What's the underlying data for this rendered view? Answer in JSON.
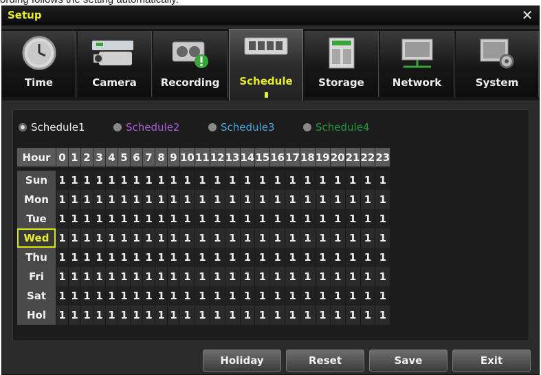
{
  "top_caption": "ording follows the setting automatically.",
  "window": {
    "title": "Setup"
  },
  "tabs": [
    {
      "id": "time",
      "label": "Time",
      "icon": "clock-icon",
      "active": false
    },
    {
      "id": "camera",
      "label": "Camera",
      "icon": "camera-icon",
      "active": false
    },
    {
      "id": "recording",
      "label": "Recording",
      "icon": "recording-icon",
      "active": false
    },
    {
      "id": "schedule",
      "label": "Schedule",
      "icon": "schedule-icon",
      "active": true
    },
    {
      "id": "storage",
      "label": "Storage",
      "icon": "storage-icon",
      "active": false
    },
    {
      "id": "network",
      "label": "Network",
      "icon": "network-icon",
      "active": false
    },
    {
      "id": "system",
      "label": "System",
      "icon": "system-gear-icon",
      "active": false
    }
  ],
  "schedules": [
    {
      "label": "Schedule1",
      "color": "#f0f0f0",
      "selected": true
    },
    {
      "label": "Schedule2",
      "color": "#a95bd6",
      "selected": false
    },
    {
      "label": "Schedule3",
      "color": "#4aa6e0",
      "selected": false
    },
    {
      "label": "Schedule4",
      "color": "#1f9a3c",
      "selected": false
    }
  ],
  "grid": {
    "hour_label": "Hour",
    "hours": [
      "0",
      "1",
      "2",
      "3",
      "4",
      "5",
      "6",
      "7",
      "8",
      "9",
      "10",
      "11",
      "12",
      "13",
      "14",
      "15",
      "16",
      "17",
      "18",
      "19",
      "20",
      "21",
      "22",
      "23"
    ],
    "rows": [
      {
        "day": "Sun",
        "values": [
          "1",
          "1",
          "1",
          "1",
          "1",
          "1",
          "1",
          "1",
          "1",
          "1",
          "1",
          "1",
          "1",
          "1",
          "1",
          "1",
          "1",
          "1",
          "1",
          "1",
          "1",
          "1",
          "1",
          "1"
        ]
      },
      {
        "day": "Mon",
        "values": [
          "1",
          "1",
          "1",
          "1",
          "1",
          "1",
          "1",
          "1",
          "1",
          "1",
          "1",
          "1",
          "1",
          "1",
          "1",
          "1",
          "1",
          "1",
          "1",
          "1",
          "1",
          "1",
          "1",
          "1"
        ]
      },
      {
        "day": "Tue",
        "values": [
          "1",
          "1",
          "1",
          "1",
          "1",
          "1",
          "1",
          "1",
          "1",
          "1",
          "1",
          "1",
          "1",
          "1",
          "1",
          "1",
          "1",
          "1",
          "1",
          "1",
          "1",
          "1",
          "1",
          "1"
        ]
      },
      {
        "day": "Wed",
        "values": [
          "1",
          "1",
          "1",
          "1",
          "1",
          "1",
          "1",
          "1",
          "1",
          "1",
          "1",
          "1",
          "1",
          "1",
          "1",
          "1",
          "1",
          "1",
          "1",
          "1",
          "1",
          "1",
          "1",
          "1"
        ],
        "focused": true
      },
      {
        "day": "Thu",
        "values": [
          "1",
          "1",
          "1",
          "1",
          "1",
          "1",
          "1",
          "1",
          "1",
          "1",
          "1",
          "1",
          "1",
          "1",
          "1",
          "1",
          "1",
          "1",
          "1",
          "1",
          "1",
          "1",
          "1",
          "1"
        ]
      },
      {
        "day": "Fri",
        "values": [
          "1",
          "1",
          "1",
          "1",
          "1",
          "1",
          "1",
          "1",
          "1",
          "1",
          "1",
          "1",
          "1",
          "1",
          "1",
          "1",
          "1",
          "1",
          "1",
          "1",
          "1",
          "1",
          "1",
          "1"
        ]
      },
      {
        "day": "Sat",
        "values": [
          "1",
          "1",
          "1",
          "1",
          "1",
          "1",
          "1",
          "1",
          "1",
          "1",
          "1",
          "1",
          "1",
          "1",
          "1",
          "1",
          "1",
          "1",
          "1",
          "1",
          "1",
          "1",
          "1",
          "1"
        ]
      },
      {
        "day": "Hol",
        "values": [
          "1",
          "1",
          "1",
          "1",
          "1",
          "1",
          "1",
          "1",
          "1",
          "1",
          "1",
          "1",
          "1",
          "1",
          "1",
          "1",
          "1",
          "1",
          "1",
          "1",
          "1",
          "1",
          "1",
          "1"
        ]
      }
    ]
  },
  "buttons": {
    "holiday": "Holiday",
    "reset": "Reset",
    "save": "Save",
    "exit": "Exit"
  },
  "colors": {
    "accent": "#e7ec2a",
    "background": "#2b2b2b"
  }
}
